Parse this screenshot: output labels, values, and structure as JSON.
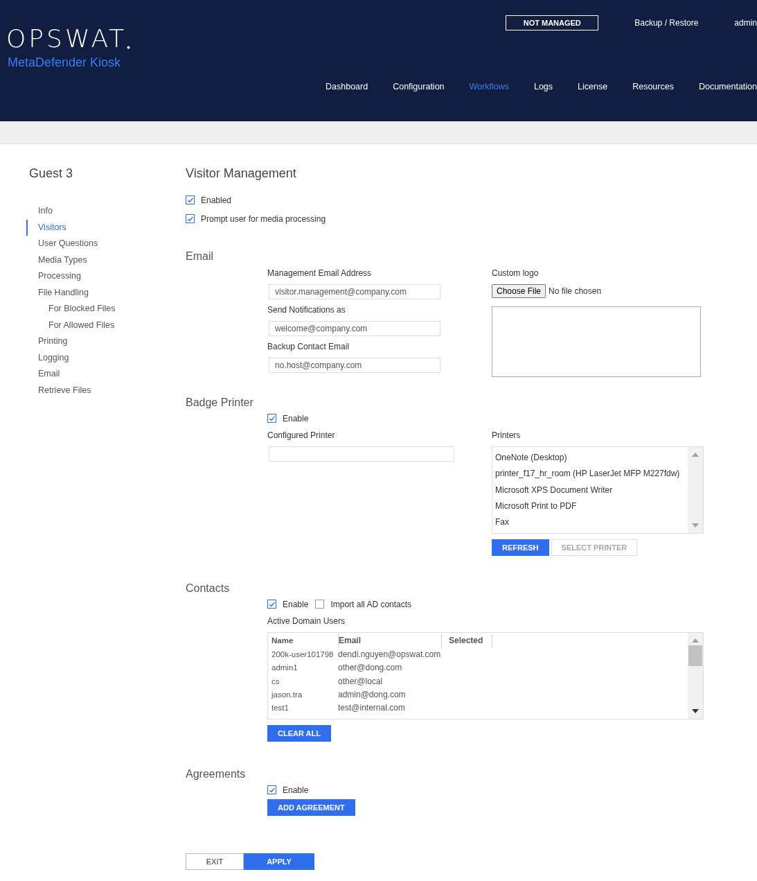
{
  "header": {
    "logo": "OPSWAT",
    "product": "MetaDefender Kiosk",
    "status": "NOT MANAGED",
    "links": [
      "Backup / Restore",
      "admin"
    ],
    "nav": [
      {
        "label": "Dashboard",
        "selected": false
      },
      {
        "label": "Configuration",
        "selected": false
      },
      {
        "label": "Workflows",
        "selected": true
      },
      {
        "label": "Logs",
        "selected": false
      },
      {
        "label": "License",
        "selected": false
      },
      {
        "label": "Resources",
        "selected": false
      },
      {
        "label": "Documentation",
        "selected": false
      }
    ]
  },
  "sidebar": {
    "title": "Guest 3",
    "items": [
      {
        "label": "Info",
        "selected": false
      },
      {
        "label": "Visitors",
        "selected": true
      },
      {
        "label": "User Questions",
        "selected": false
      },
      {
        "label": "Media Types",
        "selected": false
      },
      {
        "label": "Processing",
        "selected": false
      },
      {
        "label": "File Handling",
        "selected": false,
        "children": [
          {
            "label": "For Blocked Files",
            "selected": false
          },
          {
            "label": "For Allowed Files",
            "selected": false
          }
        ]
      },
      {
        "label": "Printing",
        "selected": false
      },
      {
        "label": "Logging",
        "selected": false
      },
      {
        "label": "Email",
        "selected": false
      },
      {
        "label": "Retrieve Files",
        "selected": false
      }
    ]
  },
  "page": {
    "title": "Visitor Management",
    "options": [
      {
        "label": "Enabled",
        "checked": true
      },
      {
        "label": "Prompt user for media processing",
        "checked": true
      }
    ]
  },
  "email": {
    "title": "Email",
    "fields": [
      {
        "label": "Management Email Address",
        "value": "visitor.management@company.com"
      },
      {
        "label": "Send Notifications as",
        "value": "welcome@company.com"
      },
      {
        "label": "Backup Contact Email",
        "value": "no.host@company.com"
      }
    ],
    "logo": {
      "label": "Custom logo",
      "button": "Choose File",
      "status": "No file chosen"
    }
  },
  "badge_printer": {
    "title": "Badge Printer",
    "enable": {
      "label": "Enable",
      "checked": true
    },
    "configured_label": "Configured Printer",
    "printers": {
      "label": "Printers",
      "items": [
        {
          "label": "OneNote (Desktop)",
          "selected": false
        },
        {
          "label": "printer_f17_hr_room (HP LaserJet MFP M227fdw)",
          "selected": false
        },
        {
          "label": "Microsoft XPS Document Writer",
          "selected": false
        },
        {
          "label": "Microsoft Print to PDF",
          "selected": false
        },
        {
          "label": "Fax",
          "selected": false
        }
      ]
    },
    "buttons": [
      {
        "label": "REFRESH",
        "disabled": false
      },
      {
        "label": "SELECT PRINTER",
        "disabled": true
      }
    ]
  },
  "contacts": {
    "title": "Contacts",
    "options": [
      {
        "label": "Enable",
        "checked": true
      },
      {
        "label": "Import all AD contacts",
        "checked": false
      }
    ],
    "table": {
      "label": "Active Domain Users",
      "columns": [
        "Name",
        "Email",
        "Selected"
      ],
      "rows": [
        [
          "200k-user101798",
          "dendi.nguyen@opswat.com"
        ],
        [
          "admin1",
          "other@dong.com"
        ],
        [
          "cs",
          "other@local"
        ],
        [
          "jason.tra",
          "admin@dong.com"
        ],
        [
          "test1",
          "test@internal.com"
        ]
      ]
    },
    "button": "CLEAR ALL"
  },
  "agreements": {
    "title": "Agreements",
    "enable": {
      "label": "Enable",
      "checked": true
    },
    "button": "ADD AGREEMENT"
  },
  "footer": [
    {
      "label": "EXIT",
      "kind": "secondary"
    },
    {
      "label": "APPLY",
      "kind": "primary"
    }
  ]
}
